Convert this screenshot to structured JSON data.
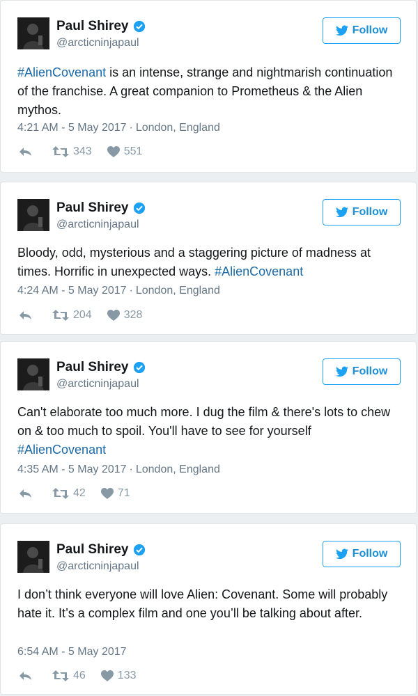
{
  "colors": {
    "link": "#1b6aa8",
    "follow_blue": "#1da1f2",
    "secondary_text": "#657786",
    "verified": "#1da1f2"
  },
  "tweets": [
    {
      "name": "Paul Shirey",
      "handle": "@arcticninjapaul",
      "follow_label": "Follow",
      "text": [
        "#AlienCovenant",
        " is an intense, strange and nightmarish continuation of the franchise. A great companion to Prometheus & the Alien mythos."
      ],
      "time": "4:21 AM - 5 May 2017",
      "sep": "·",
      "location": "London, England",
      "retweets": "343",
      "likes": "551"
    },
    {
      "name": "Paul Shirey",
      "handle": "@arcticninjapaul",
      "follow_label": "Follow",
      "text": [
        "Bloody, odd, mysterious and a staggering picture of madness at times. Horrific in unexpected ways. ",
        "#AlienCovenant"
      ],
      "time": "4:24 AM - 5 May 2017",
      "sep": "·",
      "location": "London, England",
      "retweets": "204",
      "likes": "328"
    },
    {
      "name": "Paul Shirey",
      "handle": "@arcticninjapaul",
      "follow_label": "Follow",
      "text": [
        "Can't elaborate too much more. I dug the film & there's lots to chew on & too much to spoil. You'll have to see for yourself ",
        "#AlienCovenant"
      ],
      "time": "4:35 AM - 5 May 2017",
      "sep": "·",
      "location": "London, England",
      "retweets": "42",
      "likes": "71"
    },
    {
      "name": "Paul Shirey",
      "handle": "@arcticninjapaul",
      "follow_label": "Follow",
      "text": [
        "I don’t think everyone will love Alien: Covenant. Some will probably hate it. It’s a complex film and one you’ll be talking about after."
      ],
      "time": "6:54 AM - 5 May 2017",
      "retweets": "46",
      "likes": "133"
    }
  ]
}
